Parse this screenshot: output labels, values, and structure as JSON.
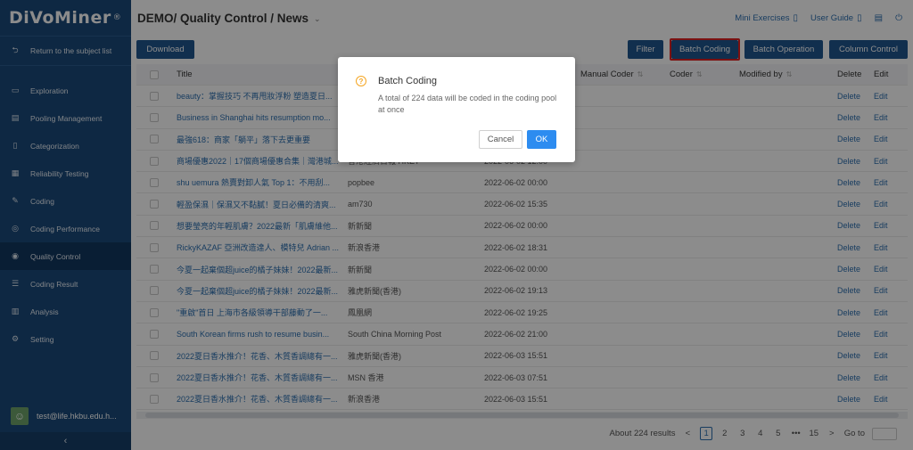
{
  "app": {
    "logo": "DiVoMiner",
    "logo_mark": "®"
  },
  "sidebar": {
    "back_label": "Return to the subject list",
    "items": [
      {
        "label": "Exploration",
        "icon": "monitor-icon"
      },
      {
        "label": "Pooling Management",
        "icon": "document-icon"
      },
      {
        "label": "Categorization",
        "icon": "document-icon"
      },
      {
        "label": "Reliability Testing",
        "icon": "clipboard-icon"
      },
      {
        "label": "Coding",
        "icon": "pencil-icon"
      },
      {
        "label": "Coding Performance",
        "icon": "gauge-icon"
      },
      {
        "label": "Quality Control",
        "icon": "eye-icon",
        "active": true
      },
      {
        "label": "Coding Result",
        "icon": "list-icon"
      },
      {
        "label": "Analysis",
        "icon": "bar-chart-icon"
      },
      {
        "label": "Setting",
        "icon": "gear-icon"
      }
    ],
    "user_email": "test@life.hkbu.edu.h...",
    "collapse_glyph": "‹"
  },
  "header": {
    "title": "DEMO/ Quality Control / News",
    "links": [
      {
        "label": "Mini Exercises"
      },
      {
        "label": "User Guide"
      }
    ]
  },
  "toolbar": {
    "download": "Download",
    "filter": "Filter",
    "batch_coding": "Batch Coding",
    "batch_operation": "Batch Operation",
    "column_control": "Column Control"
  },
  "table": {
    "columns": {
      "title": "Title",
      "manual_coder": "Manual Coder",
      "coder": "Coder",
      "modified_by": "Modified by",
      "delete": "Delete",
      "edit": "Edit"
    },
    "rows": [
      {
        "title": "beauty：掌握技巧 不再甩妝浮粉 塑造夏日...",
        "source": "",
        "date": ""
      },
      {
        "title": "Business in Shanghai hits resumption mo...",
        "source": "",
        "date": ""
      },
      {
        "title": "最強618：商家「躺平」落下去更重要",
        "source": "",
        "date": ""
      },
      {
        "title": "商場優惠2022｜17個商場優惠合集｜灣港城...",
        "source": "香港經濟日報 HKET",
        "date": "2022-06-02 12:00"
      },
      {
        "title": "shu uemura 熱賣對卸人氣 Top 1：不用刮...",
        "source": "popbee",
        "date": "2022-06-02 00:00"
      },
      {
        "title": "輕盈保濕｜保濕又不黏膩！夏日必備的清爽...",
        "source": "am730",
        "date": "2022-06-02 15:35"
      },
      {
        "title": "想要瑩亮的年輕肌膚？2022最新「肌膚維他...",
        "source": "新新聞",
        "date": "2022-06-02 00:00"
      },
      {
        "title": "RickyKAZAF 亞洲改造達人、模特兒 Adrian ...",
        "source": "新浪香港",
        "date": "2022-06-02 18:31"
      },
      {
        "title": "今夏一起棄個超juice的橘子妹妹！2022最新...",
        "source": "新新聞",
        "date": "2022-06-02 00:00"
      },
      {
        "title": "今夏一起棄個超juice的橘子妹妹！2022最新...",
        "source": "雅虎新聞(香港)",
        "date": "2022-06-02 19:13"
      },
      {
        "title": "\"重啟\"首日 上海市各級領導干部藤動了一...",
        "source": "鳳凰網",
        "date": "2022-06-02 19:25"
      },
      {
        "title": "South Korean firms rush to resume busin...",
        "source": "South China Morning Post",
        "date": "2022-06-02 21:00"
      },
      {
        "title": "2022夏日香水推介！花香、木質香調總有一...",
        "source": "雅虎新聞(香港)",
        "date": "2022-06-03 15:51"
      },
      {
        "title": "2022夏日香水推介！花香、木質香調總有一...",
        "source": "MSN 香港",
        "date": "2022-06-03 07:51"
      },
      {
        "title": "2022夏日香水推介！花香、木質香調總有一...",
        "source": "新浪香港",
        "date": "2022-06-03 15:51"
      }
    ],
    "row_delete": "Delete",
    "row_edit": "Edit"
  },
  "pagination": {
    "summary": "About 224 results",
    "pages": [
      "1",
      "2",
      "3",
      "4",
      "5",
      "•••",
      "15"
    ],
    "current": "1",
    "prev": "<",
    "next": ">",
    "goto_label": "Go to"
  },
  "modal": {
    "title": "Batch Coding",
    "body": "A total of 224 data will be coded in the coding pool at once",
    "cancel": "Cancel",
    "ok": "OK",
    "icon_glyph": "?"
  },
  "colors": {
    "sidebar": "#1b4a7a",
    "primary_button": "#20578f",
    "link": "#2d6fb0",
    "ok_button": "#2d8cf0",
    "highlight": "#e02020",
    "warning": "#f5a623"
  }
}
